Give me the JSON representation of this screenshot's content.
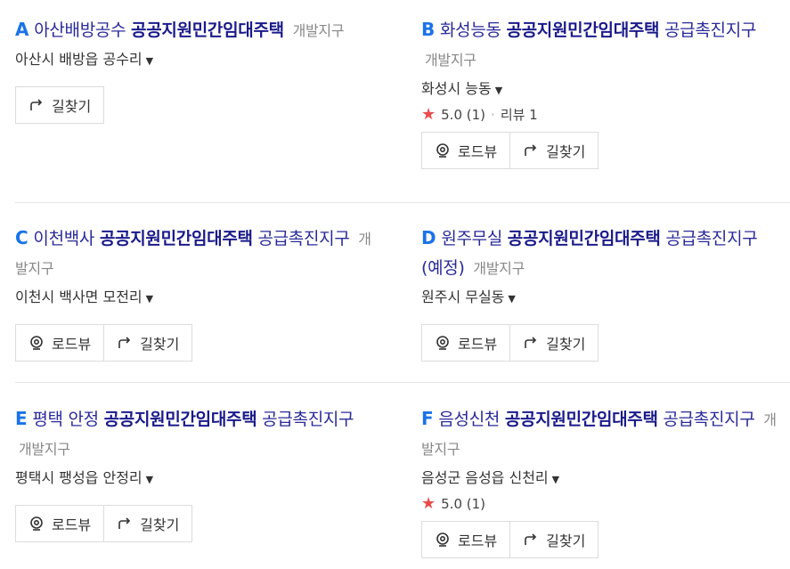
{
  "buttons": {
    "roadview": "로드뷰",
    "directions": "길찾기"
  },
  "items": [
    {
      "letter": "A",
      "prefix": "아산배방공수",
      "highlight": "공공지원민간임대주택",
      "suffix": "",
      "category": "개발지구",
      "title_line2_prefix": "",
      "address": "아산시 배방읍 공수리",
      "rating": "",
      "rating_count": "",
      "review": ""
    },
    {
      "letter": "B",
      "prefix": "화성능동",
      "highlight": "공공지원민간임대주택",
      "suffix": "공급촉진지구",
      "category": "개발지구",
      "address": "화성시 능동",
      "rating": "5.0",
      "rating_count": "(1)",
      "review": "리뷰 1"
    },
    {
      "letter": "C",
      "prefix": "이천백사",
      "highlight": "공공지원민간임대주택",
      "suffix": "공급촉진지구",
      "category": "개발지구",
      "address": "이천시 백사면 모전리"
    },
    {
      "letter": "D",
      "prefix": "원주무실",
      "highlight": "공공지원민간임대주택",
      "suffix": "공급촉진지구 (예정)",
      "category": "개발지구",
      "address": "원주시 무실동"
    },
    {
      "letter": "E",
      "prefix": "평택 안정",
      "highlight": "공공지원민간임대주택",
      "suffix": "공급촉진지구",
      "category": "개발지구",
      "address": "평택시 팽성읍 안정리"
    },
    {
      "letter": "F",
      "prefix": "음성신천",
      "highlight": "공공지원민간임대주택",
      "suffix": "공급촉진지구",
      "category": "개발지구",
      "address": "음성군 음성읍 신천리",
      "rating": "5.0",
      "rating_count": "(1)"
    }
  ],
  "colors": {
    "letter": "#1a73e8",
    "title": "#2a2a9a",
    "star": "#e94b4b"
  },
  "icons": {
    "roadview": "roadview-pin-icon",
    "directions": "turn-arrow-icon",
    "star": "star-icon",
    "caret": "caret-down-icon"
  }
}
